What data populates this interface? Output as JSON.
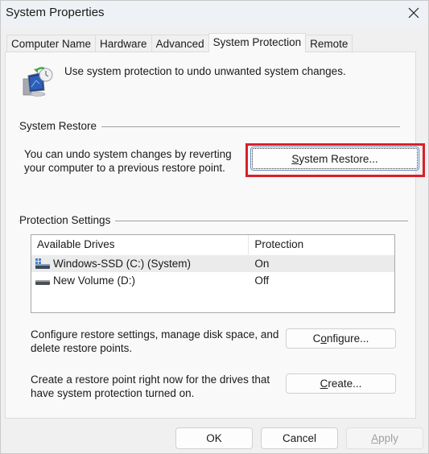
{
  "window": {
    "title": "System Properties",
    "close_icon": "close-x-icon"
  },
  "tabs": [
    {
      "label": "Computer Name",
      "active": false
    },
    {
      "label": "Hardware",
      "active": false
    },
    {
      "label": "Advanced",
      "active": false
    },
    {
      "label": "System Protection",
      "active": true
    },
    {
      "label": "Remote",
      "active": false
    }
  ],
  "intro": {
    "icon": "system-restore-icon",
    "text": "Use system protection to undo unwanted system changes."
  },
  "system_restore": {
    "group_label": "System Restore",
    "description_line1": "You can undo system changes by reverting",
    "description_line2": "your computer to a previous restore point.",
    "button_label_prefix": "",
    "button_label_mnemonic": "S",
    "button_label_rest": "ystem Restore...",
    "highlight_color": "#d9202a"
  },
  "protection_settings": {
    "group_label": "Protection Settings",
    "columns": [
      "Available Drives",
      "Protection"
    ],
    "drives": [
      {
        "name": "Windows-SSD (C:) (System)",
        "protection": "On",
        "icon": "system-drive-icon",
        "selected": true
      },
      {
        "name": "New Volume (D:)",
        "protection": "Off",
        "icon": "drive-icon",
        "selected": false
      }
    ],
    "configure": {
      "description_line1": "Configure restore settings, manage disk space, and",
      "description_line2": "delete restore points.",
      "button_label_prefix": "C",
      "button_label_mnemonic": "o",
      "button_label_rest": "nfigure..."
    },
    "create": {
      "description_line1": "Create a restore point right now for the drives that",
      "description_line2": "have system protection turned on.",
      "button_label_prefix": "",
      "button_label_mnemonic": "C",
      "button_label_rest": "reate..."
    }
  },
  "footer": {
    "ok_label": "OK",
    "cancel_label": "Cancel",
    "apply_mnemonic": "A",
    "apply_rest": "pply",
    "apply_disabled": true
  }
}
